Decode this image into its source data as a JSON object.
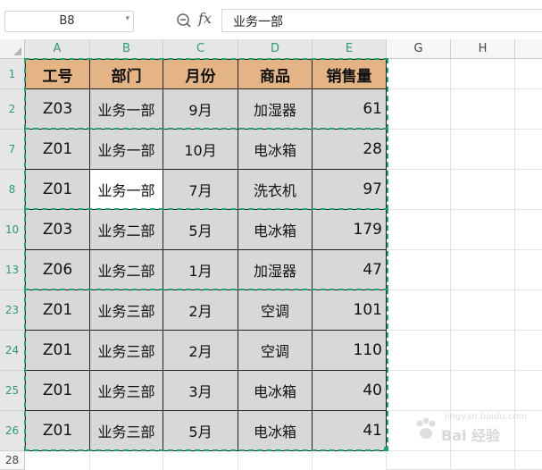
{
  "formula_bar": {
    "name_box": "B8",
    "fx_label": "fx",
    "formula": "业务一部"
  },
  "columns": [
    "A",
    "B",
    "C",
    "D",
    "E",
    "G",
    "H"
  ],
  "rows": [
    {
      "label": "1",
      "cells": [
        "工号",
        "部门",
        "月份",
        "商品",
        "销售量"
      ]
    },
    {
      "label": "2",
      "cells": [
        "Z03",
        "业务一部",
        "9月",
        "加湿器",
        "61"
      ]
    },
    {
      "label": "7",
      "cells": [
        "Z01",
        "业务一部",
        "10月",
        "电冰箱",
        "28"
      ]
    },
    {
      "label": "8",
      "cells": [
        "Z01",
        "业务一部",
        "7月",
        "洗衣机",
        "97"
      ]
    },
    {
      "label": "10",
      "cells": [
        "Z03",
        "业务二部",
        "5月",
        "电冰箱",
        "179"
      ]
    },
    {
      "label": "13",
      "cells": [
        "Z06",
        "业务二部",
        "1月",
        "加湿器",
        "47"
      ]
    },
    {
      "label": "23",
      "cells": [
        "Z01",
        "业务三部",
        "2月",
        "空调",
        "101"
      ]
    },
    {
      "label": "24",
      "cells": [
        "Z01",
        "业务三部",
        "2月",
        "空调",
        "110"
      ]
    },
    {
      "label": "25",
      "cells": [
        "Z01",
        "业务三部",
        "3月",
        "电冰箱",
        "40"
      ]
    },
    {
      "label": "26",
      "cells": [
        "Z01",
        "业务三部",
        "5月",
        "电冰箱",
        "41"
      ]
    },
    {
      "label": "28",
      "cells": [
        "",
        "",
        "",
        "",
        ""
      ]
    }
  ],
  "selected_cell": "B8",
  "watermark": {
    "text": "Bai 经验",
    "subtext": "jingyan.baidu.com"
  },
  "colors": {
    "header_fill": "#e4b486",
    "data_fill": "#d8d8d8",
    "marquee": "#1fa36a",
    "active_header": "#2e9a6e"
  }
}
